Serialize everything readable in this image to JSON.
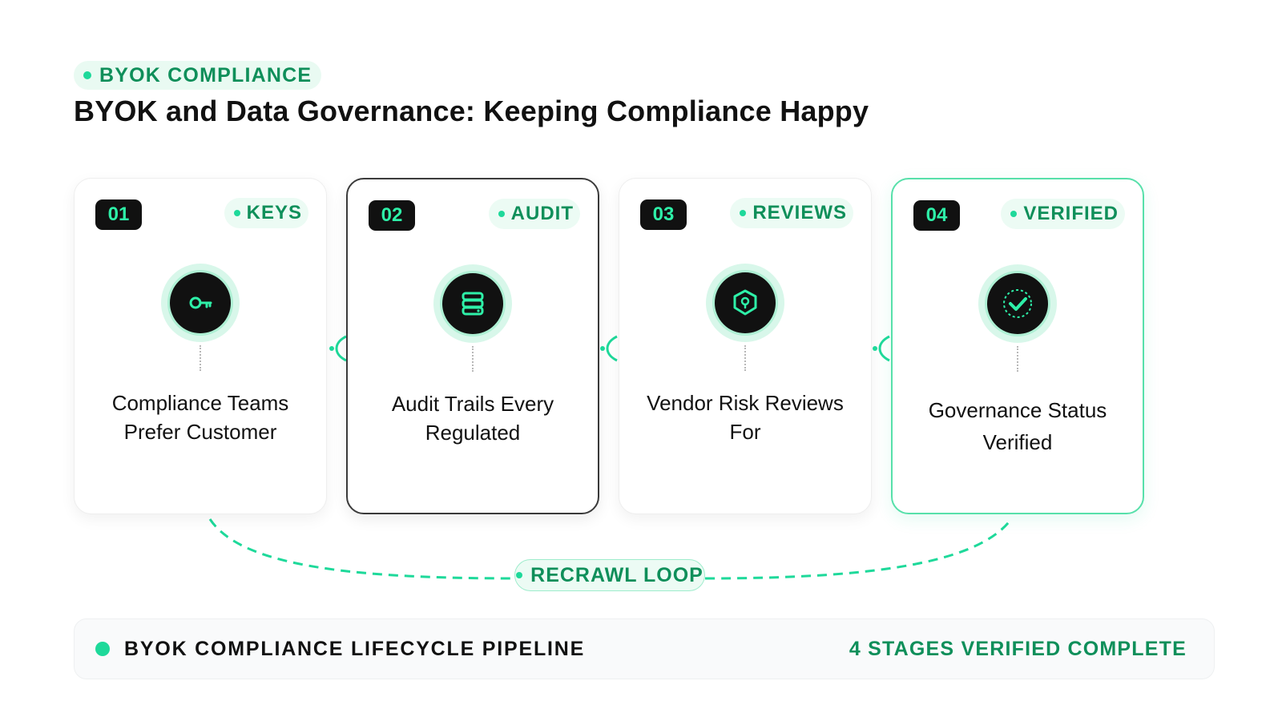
{
  "header": {
    "eyebrow": "BYOK COMPLIANCE",
    "title": "BYOK and Data Governance: Keeping Compliance Happy"
  },
  "colors": {
    "accent": "#1ed99a",
    "accent_text": "#0f8f5a",
    "dark": "#111111"
  },
  "stages": [
    {
      "number": "01",
      "tag": "KEYS",
      "icon": "key-icon",
      "text": "Compliance Teams Prefer Customer"
    },
    {
      "number": "02",
      "tag": "AUDIT",
      "icon": "database-icon",
      "text": "Audit Trails Every Regulated"
    },
    {
      "number": "03",
      "tag": "REVIEWS",
      "icon": "shield-icon",
      "text": "Vendor Risk Reviews For"
    },
    {
      "number": "04",
      "tag": "VERIFIED",
      "icon": "check-circle-icon",
      "text": "Governance Status Verified"
    }
  ],
  "loop": {
    "label": "RECRAWL LOOP"
  },
  "footer": {
    "title": "BYOK COMPLIANCE LIFECYCLE PIPELINE",
    "status": "4 STAGES VERIFIED COMPLETE"
  }
}
